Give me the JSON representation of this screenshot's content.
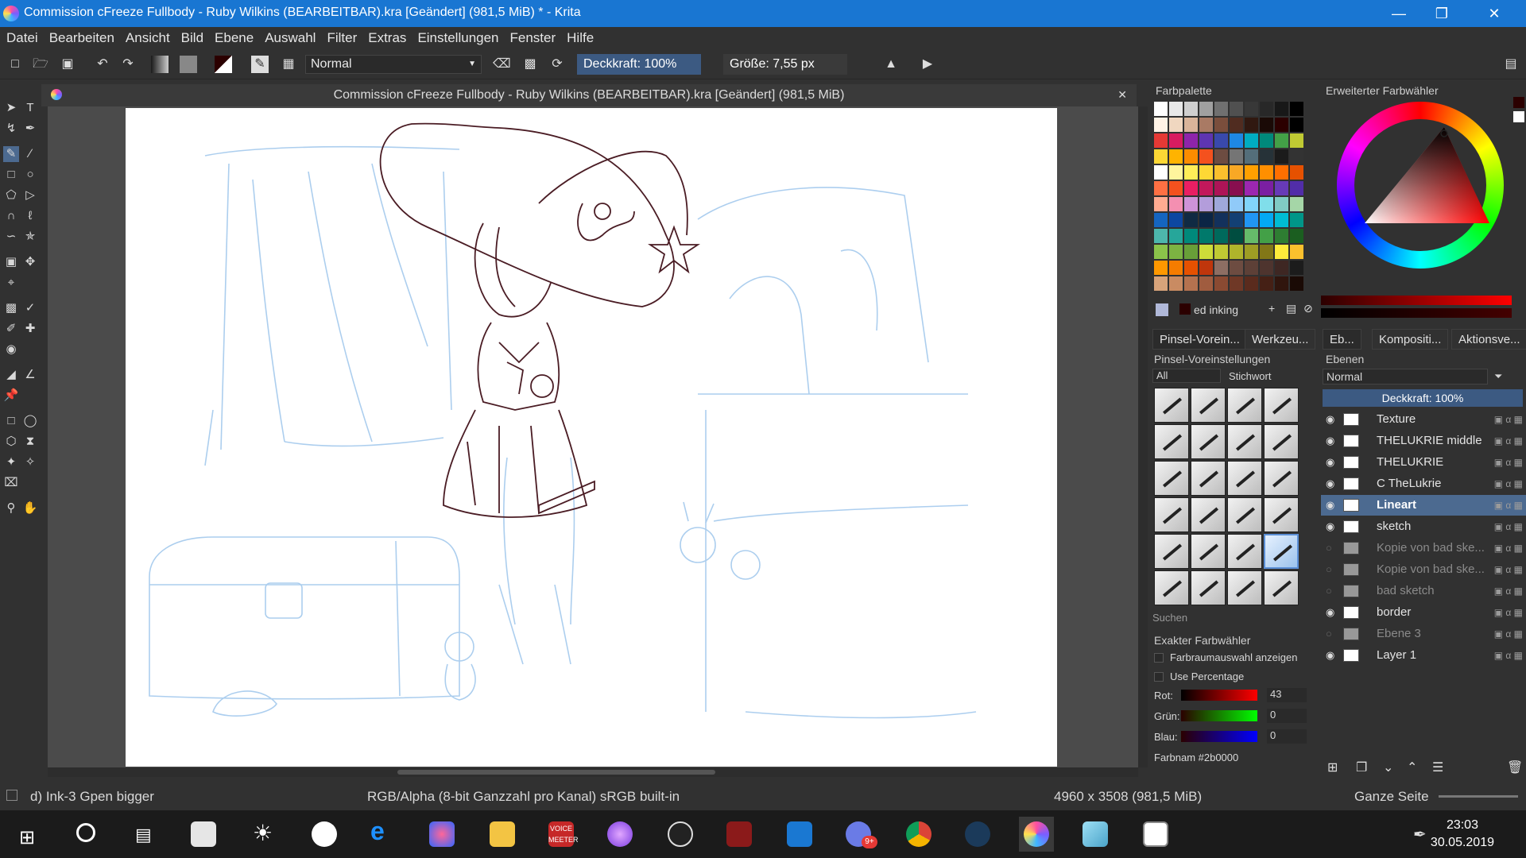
{
  "window": {
    "title": "Commission cFreeze Fullbody - Ruby Wilkins (BEARBEITBAR).kra [Geändert]  (981,5 MiB) * - Krita"
  },
  "menu": [
    "Datei",
    "Bearbeiten",
    "Ansicht",
    "Bild",
    "Ebene",
    "Auswahl",
    "Filter",
    "Extras",
    "Einstellungen",
    "Fenster",
    "Hilfe"
  ],
  "toolbar": {
    "blend_mode": "Normal",
    "opacity": "Deckkraft:  100%",
    "size": "Größe:  7,55 px"
  },
  "document_tab": "Commission cFreeze Fullbody - Ruby Wilkins (BEARBEITBAR).kra [Geändert]  (981,5 MiB)",
  "status": {
    "brush": "d) Ink-3 Gpen bigger",
    "color_space": "RGB/Alpha (8-bit Ganzzahl pro Kanal)  sRGB built-in",
    "dimensions": "4960 x 3508 (981,5 MiB)",
    "zoom": "Ganze Seite"
  },
  "palette": {
    "title": "Farbpalette",
    "name": "ed inking"
  },
  "color_selector": {
    "title": "Erweiterter Farbwähler"
  },
  "brush_panel": {
    "tabs": [
      "Pinsel-Vorein...",
      "Werkzeu..."
    ],
    "title": "Pinsel-Voreinstellungen",
    "filter": "All",
    "tag": "Stichwort",
    "search": "Suchen"
  },
  "exact_color": {
    "title": "Exakter Farbwähler",
    "opt1": "Farbraumauswahl anzeigen",
    "opt2": "Use Percentage",
    "rot_label": "Rot:",
    "rot": "43",
    "gruen_label": "Grün:",
    "gruen": "0",
    "blau_label": "Blau:",
    "blau": "0",
    "name": "Farbnam #2b0000"
  },
  "layers_panel": {
    "tabs": [
      "Eb...",
      "Kompositi...",
      "Aktionsve..."
    ],
    "title": "Ebenen",
    "blend": "Normal",
    "opacity": "Deckkraft:  100%",
    "layers": [
      {
        "name": "Texture",
        "visible": true,
        "active": false
      },
      {
        "name": "THELUKRIE middle",
        "visible": true,
        "active": false
      },
      {
        "name": "THELUKRIE",
        "visible": true,
        "active": false
      },
      {
        "name": "C TheLukrie",
        "visible": true,
        "active": false
      },
      {
        "name": "Lineart",
        "visible": true,
        "active": true
      },
      {
        "name": "sketch",
        "visible": true,
        "active": false
      },
      {
        "name": "Kopie von bad ske...",
        "visible": false,
        "active": false
      },
      {
        "name": "Kopie von bad ske...",
        "visible": false,
        "active": false
      },
      {
        "name": "bad sketch",
        "visible": false,
        "active": false
      },
      {
        "name": "border",
        "visible": true,
        "active": false
      },
      {
        "name": "Ebene 3",
        "visible": false,
        "active": false
      },
      {
        "name": "Layer 1",
        "visible": true,
        "active": false
      }
    ]
  },
  "taskbar": {
    "time": "23:03",
    "date": "30.05.2019",
    "voicemeeter": "VOICE MEETER",
    "badge": "9+"
  }
}
